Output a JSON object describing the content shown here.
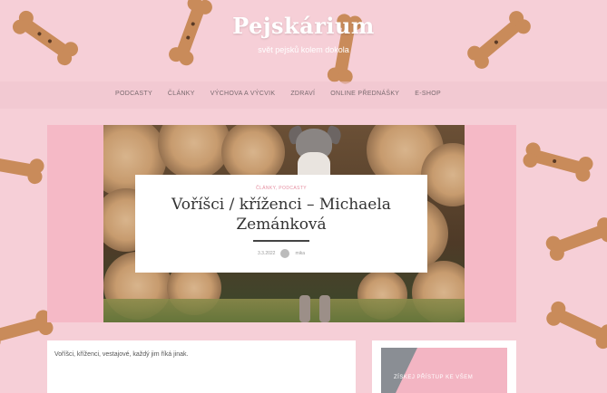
{
  "site": {
    "title": "Pejskárium",
    "tagline": "svět pejsků kolem dokola"
  },
  "nav": {
    "items": [
      "PODCASTY",
      "ČLÁNKY",
      "VÝCHOVA A VÝCVIK",
      "ZDRAVÍ",
      "ONLINE PŘEDNÁŠKY",
      "E-SHOP"
    ]
  },
  "post": {
    "categories": "ČLÁNKY, PODCASTY",
    "title": "Voříšci / kříženci – Michaela Zemánková",
    "date": "3.3.2022",
    "author": "mika"
  },
  "content": {
    "excerpt": "Voříšci, kříženci, vestajové, každý jim říká jinak."
  },
  "promo": {
    "text": "ZÍSKEJ PŘÍSTUP KE VŠEM"
  },
  "colors": {
    "background": "#f6cfd7",
    "accent": "#e58ea0",
    "hero_pink": "#f5b9c6"
  }
}
